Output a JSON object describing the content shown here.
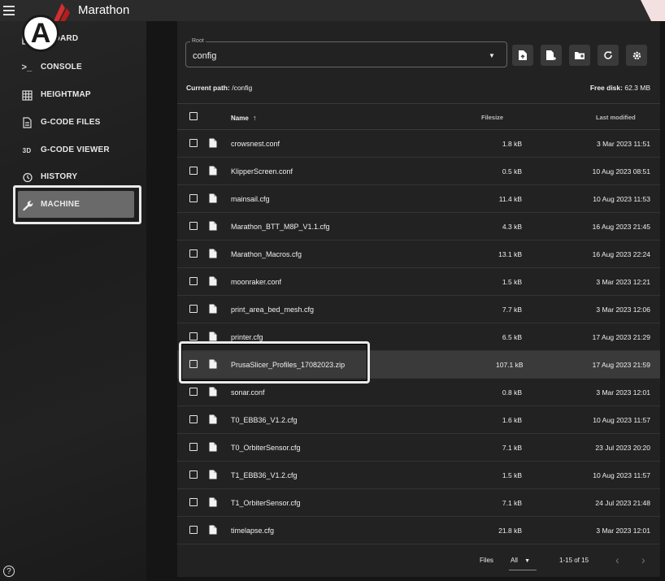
{
  "app": {
    "title": "Marathon",
    "badge": "A",
    "help": "?"
  },
  "sidebar": {
    "items": [
      {
        "label": "DASHBOARD",
        "visible_label": "OARD",
        "icon": "dashboard-icon"
      },
      {
        "label": "CONSOLE",
        "icon": "console-icon",
        "glyph": ">_"
      },
      {
        "label": "HEIGHTMAP",
        "icon": "grid-icon"
      },
      {
        "label": "G-CODE FILES",
        "icon": "file-list-icon"
      },
      {
        "label": "G-CODE VIEWER",
        "icon": "3d-icon",
        "glyph": "3D"
      },
      {
        "label": "HISTORY",
        "icon": "history-icon"
      },
      {
        "label": "MACHINE",
        "icon": "wrench-icon",
        "active": true
      }
    ]
  },
  "toolbar": {
    "root_label": "Root",
    "root_value": "config",
    "buttons": [
      "upload-file-icon",
      "create-file-icon",
      "create-folder-icon",
      "refresh-icon",
      "settings-icon"
    ]
  },
  "path": {
    "label": "Current path:",
    "value": "/config"
  },
  "disk": {
    "label": "Free disk:",
    "value": "62.3 MB"
  },
  "table": {
    "headers": {
      "name": "Name",
      "sort": "↑",
      "size": "Filesize",
      "modified": "Last modified"
    },
    "rows": [
      {
        "name": "crowsnest.conf",
        "size": "1.8 kB",
        "modified": "3 Mar 2023 11:51"
      },
      {
        "name": "KlipperScreen.conf",
        "size": "0.5 kB",
        "modified": "10 Aug 2023 08:51"
      },
      {
        "name": "mainsail.cfg",
        "size": "11.4 kB",
        "modified": "10 Aug 2023 11:53"
      },
      {
        "name": "Marathon_BTT_M8P_V1.1.cfg",
        "size": "4.3 kB",
        "modified": "16 Aug 2023 21:45"
      },
      {
        "name": "Marathon_Macros.cfg",
        "size": "13.1 kB",
        "modified": "16 Aug 2023 22:24"
      },
      {
        "name": "moonraker.conf",
        "size": "1.5 kB",
        "modified": "3 Mar 2023 12:21"
      },
      {
        "name": "print_area_bed_mesh.cfg",
        "size": "7.7 kB",
        "modified": "3 Mar 2023 12:06"
      },
      {
        "name": "printer.cfg",
        "size": "6.5 kB",
        "modified": "17 Aug 2023 21:29"
      },
      {
        "name": "PrusaSlicer_Profiles_17082023.zip",
        "size": "107.1 kB",
        "modified": "17 Aug 2023 21:59",
        "highlighted": true
      },
      {
        "name": "sonar.conf",
        "size": "0.8 kB",
        "modified": "3 Mar 2023 12:01"
      },
      {
        "name": "T0_EBB36_V1.2.cfg",
        "size": "1.6 kB",
        "modified": "10 Aug 2023 11:57"
      },
      {
        "name": "T0_OrbiterSensor.cfg",
        "size": "7.1 kB",
        "modified": "23 Jul 2023 20:20"
      },
      {
        "name": "T1_EBB36_V1.2.cfg",
        "size": "1.5 kB",
        "modified": "10 Aug 2023 11:57"
      },
      {
        "name": "T1_OrbiterSensor.cfg",
        "size": "7.1 kB",
        "modified": "24 Jul 2023 21:48"
      },
      {
        "name": "timelapse.cfg",
        "size": "21.8 kB",
        "modified": "3 Mar 2023 12:01"
      }
    ]
  },
  "footer": {
    "files_label": "Files",
    "per_page": "All",
    "range": "1-15 of 15",
    "prev": "‹",
    "next": "›"
  }
}
